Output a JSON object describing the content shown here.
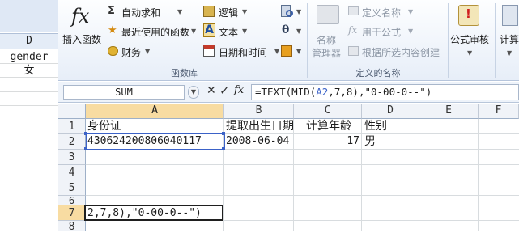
{
  "background_sheet": {
    "column_header": "D",
    "cells": [
      "gender",
      "女"
    ]
  },
  "ribbon": {
    "insert_function": {
      "label": "插入函数",
      "glyph": "fx"
    },
    "autosum": {
      "label": "自动求和",
      "icon": "sigma-icon"
    },
    "recent": {
      "label": "最近使用的函数",
      "icon": "star-icon"
    },
    "financial": {
      "label": "财务",
      "icon": "coins-icon"
    },
    "logical": {
      "label": "逻辑",
      "icon": "book-icon"
    },
    "text": {
      "label": "文本",
      "icon": "text-a-icon"
    },
    "datetime": {
      "label": "日期和时间",
      "icon": "calendar-icon"
    },
    "lookup": {
      "icon": "lookup-icon"
    },
    "math": {
      "icon": "theta-icon",
      "glyph": "θ"
    },
    "more": {
      "icon": "more-functions-icon"
    },
    "function_library_label": "函数库",
    "name_manager": {
      "label_line1": "名称",
      "label_line2": "管理器"
    },
    "define_name": {
      "label": "定义名称"
    },
    "use_in_formula": {
      "label": "用于公式"
    },
    "create_from_selection": {
      "label": "根据所选内容创建"
    },
    "defined_names_label": "定义的名称",
    "formula_auditing": {
      "label": "公式审核"
    },
    "calculation": {
      "label": "计算"
    }
  },
  "formula_bar": {
    "name_box": "SUM",
    "cancel": "✕",
    "enter": "✓",
    "fx": "fx",
    "formula_pre": "=TEXT(MID(",
    "formula_ref": "A2",
    "formula_post": ",7,8),\"0-00-0--\")"
  },
  "grid": {
    "columns": [
      "A",
      "B",
      "C",
      "D",
      "E",
      "F"
    ],
    "rows": [
      "1",
      "2",
      "3",
      "4",
      "5",
      "6",
      "7",
      "8"
    ],
    "row1": {
      "a": "身份证",
      "b": "提取出生日期",
      "c": "计算年龄",
      "d": "性别"
    },
    "row2": {
      "a": "430624200806040117",
      "b": "2008-06-04",
      "c": "17",
      "d": "男"
    },
    "row7_edit": "2,7,8),\"0-00-0--\")"
  },
  "colors": {
    "selected_header": "#f8dca2",
    "active_border": "#1f1f1f",
    "range_highlight": "#3b62c8"
  }
}
